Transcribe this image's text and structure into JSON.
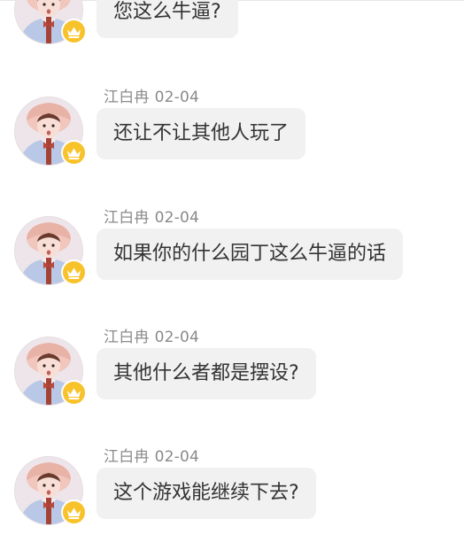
{
  "messages": [
    {
      "id": 1,
      "sender": "",
      "date": "",
      "text": "您这么牛逼?"
    },
    {
      "id": 2,
      "sender": "江白冉",
      "date": "02-04",
      "text": "还让不让其他人玩了"
    },
    {
      "id": 3,
      "sender": "江白冉",
      "date": "02-04",
      "text": "如果你的什么园丁这么牛逼的话"
    },
    {
      "id": 4,
      "sender": "江白冉",
      "date": "02-04",
      "text": "其他什么者都是摆设?"
    },
    {
      "id": 5,
      "sender": "江白冉",
      "date": "02-04",
      "text": "这个游戏能继续下去?"
    }
  ],
  "colors": {
    "bubble_bg": "#f1f1f1",
    "meta_text": "#8a8a8a",
    "message_text": "#333333",
    "badge": "#f8c22a"
  },
  "icons": {
    "badge": "crown-icon"
  }
}
